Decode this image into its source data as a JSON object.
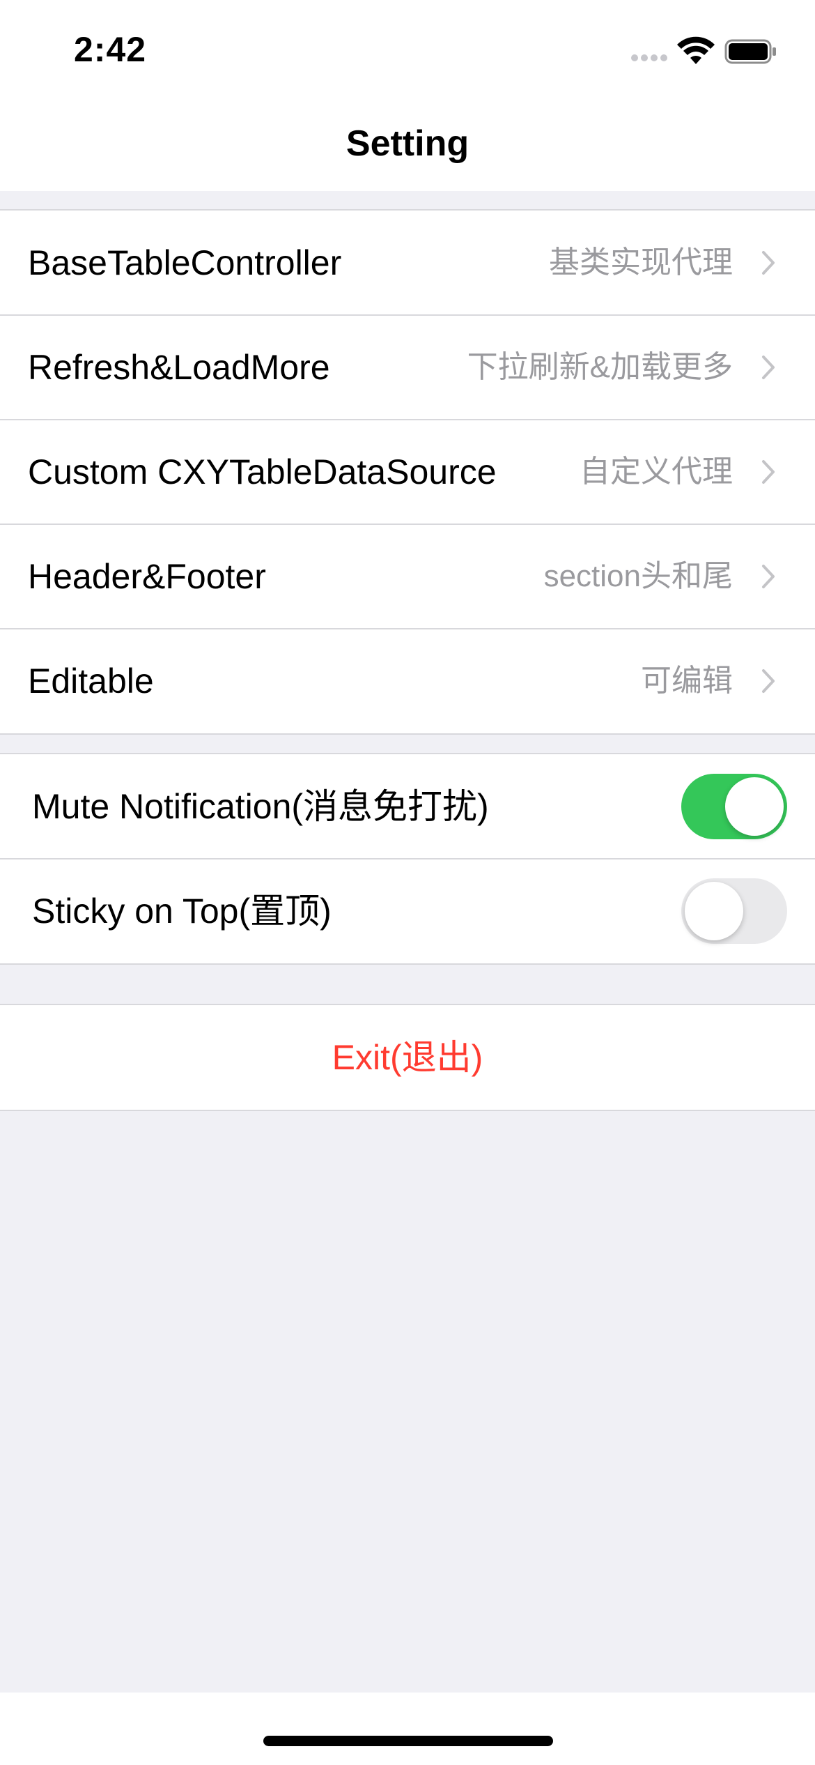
{
  "status_bar": {
    "time": "2:42"
  },
  "nav": {
    "title": "Setting"
  },
  "menu_group": {
    "items": [
      {
        "label": "BaseTableController",
        "detail": "基类实现代理"
      },
      {
        "label": "Refresh&LoadMore",
        "detail": "下拉刷新&加载更多"
      },
      {
        "label": "Custom CXYTableDataSource",
        "detail": "自定义代理"
      },
      {
        "label": "Header&Footer",
        "detail": "section头和尾"
      },
      {
        "label": "Editable",
        "detail": "可编辑"
      }
    ]
  },
  "toggle_group": {
    "items": [
      {
        "label": "Mute Notification(消息免打扰)",
        "on": true
      },
      {
        "label": "Sticky on Top(置顶)",
        "on": false
      }
    ]
  },
  "exit_group": {
    "label": "Exit(退出)"
  },
  "colors": {
    "accent_switch": "#34c759",
    "destructive": "#ff3b30",
    "background": "#f0f0f5"
  }
}
